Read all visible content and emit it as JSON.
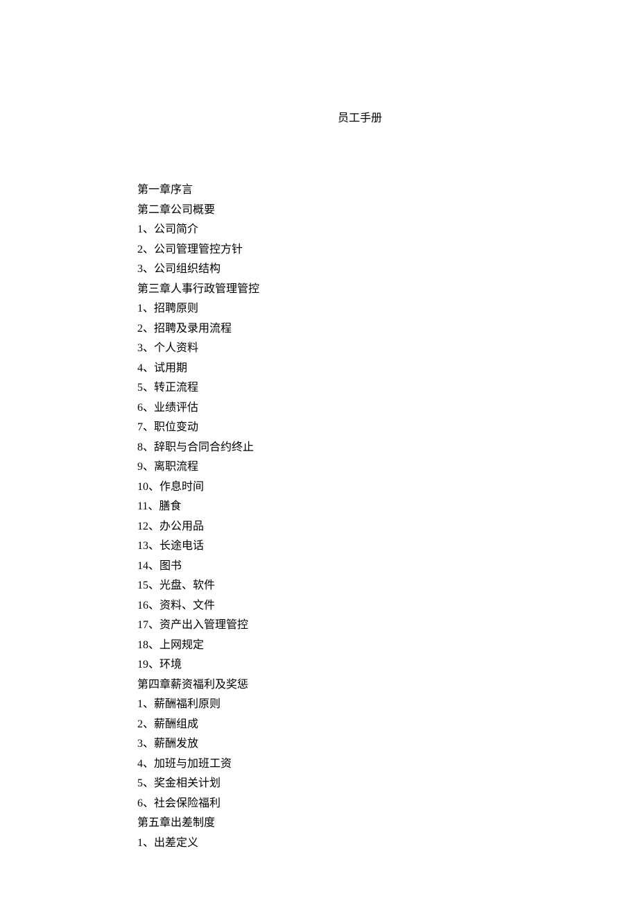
{
  "title": "员工手册",
  "toc": [
    "第一章序言",
    "第二章公司概要",
    "1、公司简介",
    "2、公司管理管控方针",
    "3、公司组织结构",
    "第三章人事行政管理管控",
    "1、招聘原则",
    "2、招聘及录用流程",
    "3、个人资料",
    "4、试用期",
    "5、转正流程",
    "6、业绩评估",
    "7、职位变动",
    "8、辞职与合同合约终止",
    "9、离职流程",
    "10、作息时间",
    "11、膳食",
    "12、办公用品",
    "13、长途电话",
    "14、图书",
    "15、光盘、软件",
    "16、资料、文件",
    "17、资产出入管理管控",
    "18、上网规定",
    "19、环境",
    "第四章薪资福利及奖惩",
    "1、薪酬福利原则",
    "2、薪酬组成",
    "3、薪酬发放",
    "4、加班与加班工资",
    "5、奖金相关计划",
    "6、社会保险福利",
    "第五章出差制度",
    "1、出差定义"
  ]
}
